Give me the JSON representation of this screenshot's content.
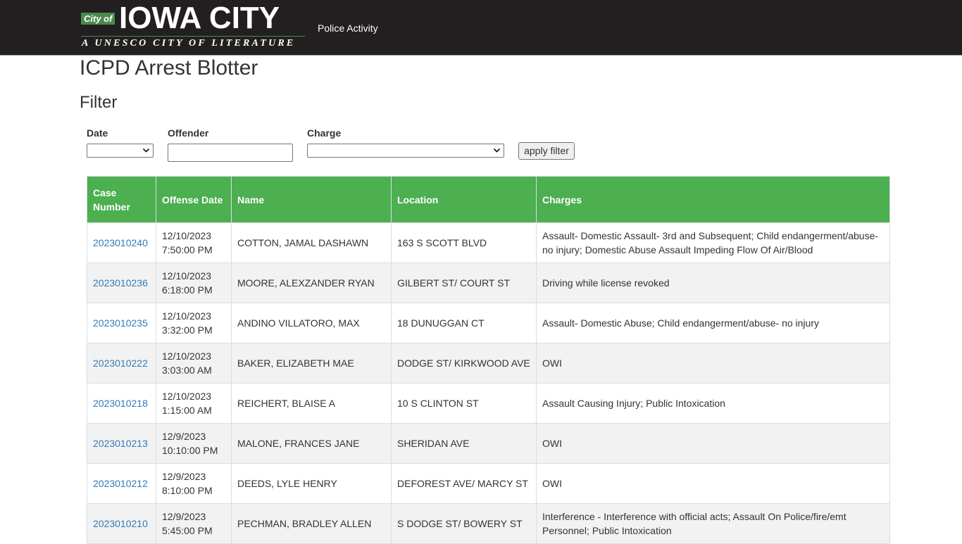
{
  "header": {
    "logo_city_of": "City of",
    "logo_city_name": "IOWA CITY",
    "logo_tagline": "A UNESCO CITY OF LITERATURE",
    "nav_link": "Police Activity"
  },
  "page": {
    "title": "ICPD Arrest Blotter",
    "filter_heading": "Filter"
  },
  "filter": {
    "date_label": "Date",
    "offender_label": "Offender",
    "offender_value": "",
    "charge_label": "Charge",
    "apply_label": "apply filter"
  },
  "table": {
    "headers": [
      "Case Number",
      "Offense Date",
      "Name",
      "Location",
      "Charges"
    ],
    "rows": [
      {
        "case": "2023010240",
        "date": "12/10/2023",
        "time": "7:50:00 PM",
        "name": "COTTON, JAMAL DASHAWN",
        "location": "163 S SCOTT BLVD",
        "charges": "Assault- Domestic Assault- 3rd and Subsequent; Child endangerment/abuse- no injury; Domestic Abuse Assault Impeding Flow Of Air/Blood"
      },
      {
        "case": "2023010236",
        "date": "12/10/2023",
        "time": "6:18:00 PM",
        "name": "MOORE, ALEXZANDER RYAN",
        "location": "GILBERT ST/ COURT ST",
        "charges": "Driving while license revoked"
      },
      {
        "case": "2023010235",
        "date": "12/10/2023",
        "time": "3:32:00 PM",
        "name": "ANDINO VILLATORO, MAX",
        "location": "18 DUNUGGAN CT",
        "charges": "Assault- Domestic Abuse; Child endangerment/abuse- no injury"
      },
      {
        "case": "2023010222",
        "date": "12/10/2023",
        "time": "3:03:00 AM",
        "name": "BAKER, ELIZABETH MAE",
        "location": "DODGE ST/ KIRKWOOD AVE",
        "charges": "OWI"
      },
      {
        "case": "2023010218",
        "date": "12/10/2023",
        "time": "1:15:00 AM",
        "name": "REICHERT, BLAISE A",
        "location": "10 S CLINTON ST",
        "charges": "Assault Causing Injury; Public Intoxication"
      },
      {
        "case": "2023010213",
        "date": "12/9/2023",
        "time": "10:10:00 PM",
        "name": "MALONE, FRANCES JANE",
        "location": "SHERIDAN AVE",
        "charges": "OWI"
      },
      {
        "case": "2023010212",
        "date": "12/9/2023",
        "time": "8:10:00 PM",
        "name": "DEEDS, LYLE HENRY",
        "location": "DEFOREST AVE/ MARCY ST",
        "charges": "OWI"
      },
      {
        "case": "2023010210",
        "date": "12/9/2023",
        "time": "5:45:00 PM",
        "name": "PECHMAN, BRADLEY ALLEN",
        "location": "S DODGE ST/ BOWERY ST",
        "charges": "Interference - Interference with official acts; Assault On Police/fire/emt Personnel; Public Intoxication"
      }
    ]
  },
  "colors": {
    "header_bg": "#231f20",
    "table_header": "#4caf50",
    "link": "#337ab7",
    "logo_green": "#4a8a4c"
  }
}
